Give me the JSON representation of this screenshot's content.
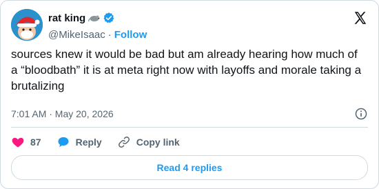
{
  "author": {
    "display_name": "rat king",
    "handle": "@MikeIsaac",
    "follow_label": "Follow",
    "separator": "·",
    "avatar": "santa-hat-cartoon-avatar"
  },
  "tweet": {
    "text": "sources knew it would be bad but am already hearing how much of a “bloodbath” it is at meta right now with layoffs and morale taking a brutalizing",
    "time": "7:01 AM · May 20, 2026"
  },
  "actions": {
    "like_count": "87",
    "reply_label": "Reply",
    "copy_link_label": "Copy link"
  },
  "footer": {
    "read_replies_label": "Read 4 replies"
  },
  "colors": {
    "accent": "#1d9bf0",
    "like": "#f91880",
    "text": "#0f1419",
    "muted": "#536471",
    "border": "#cfd9de"
  },
  "icons": [
    "rat-emoji-icon",
    "verified-badge-icon",
    "x-logo-icon",
    "info-icon",
    "heart-icon",
    "reply-bubble-icon",
    "link-icon"
  ]
}
